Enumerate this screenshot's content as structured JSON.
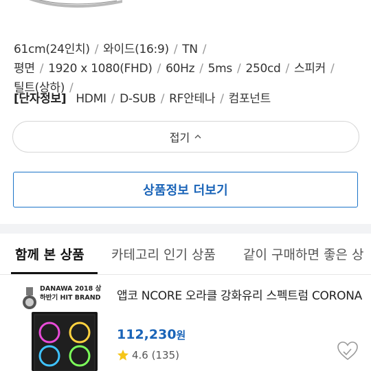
{
  "specs": {
    "items": [
      "61cm(24인치)",
      "와이드(16:9)",
      "TN",
      "평면",
      "1920 x 1080(FHD)",
      "60Hz",
      "5ms",
      "250cd",
      "스피커",
      "틸트(상하)"
    ]
  },
  "terminal": {
    "label": "[단자정보]",
    "items": [
      "HDMI",
      "D-SUB",
      "RF안테나",
      "컴포넌트"
    ]
  },
  "fold_button": {
    "label": "접기"
  },
  "more_button": {
    "label": "상품정보 더보기"
  },
  "tabs": [
    {
      "label": "함께 본 상품",
      "active": true
    },
    {
      "label": "카테고리 인기 상품",
      "active": false
    },
    {
      "label": "같이 구매하면 좋은 상",
      "active": false
    }
  ],
  "product": {
    "badge_line1": "DANAWA 2018 상",
    "badge_line2": "하반기 HIT BRAND",
    "title": "앱코 NCORE 오라클 강화유리 스펙트럼 CORONA",
    "price": "112,230",
    "price_unit": "원",
    "rating": "4.6",
    "review_count": "(135)"
  },
  "colors": {
    "accent_blue": "#1a64b8",
    "star": "#f5c518"
  }
}
